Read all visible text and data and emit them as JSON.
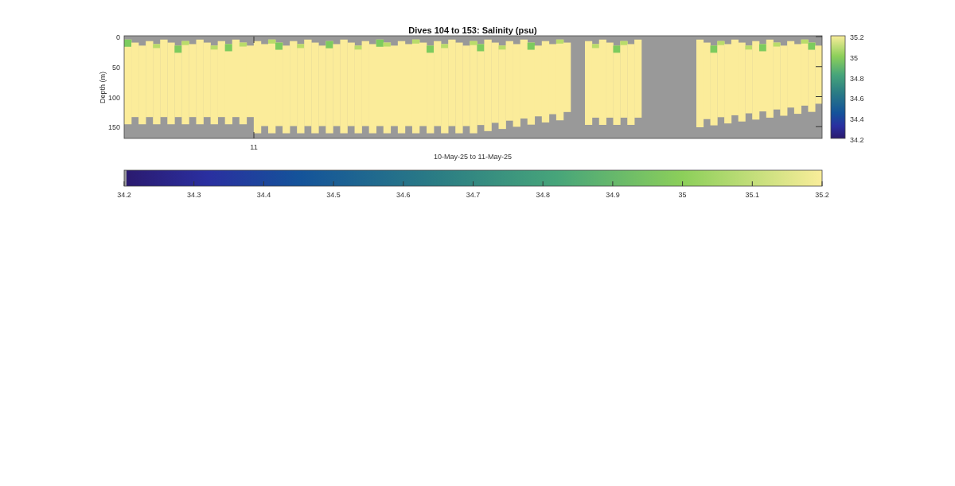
{
  "figure": {
    "title": "Dives 104 to 153: Salinity (psu)",
    "ylabel": "Depth (m)",
    "depth_ticks": [
      "0",
      "50",
      "100",
      "150"
    ],
    "time_ticks": [
      "11"
    ],
    "xlabel": "10-May-25 to 11-May-25",
    "side_colorbar_ticks": [
      "35.2",
      "35",
      "34.8",
      "34.6",
      "34.4",
      "34.2"
    ],
    "bottom_colorbar_ticks": [
      "34.2",
      "34.3",
      "34.4",
      "34.5",
      "34.6",
      "34.7",
      "34.8",
      "34.9",
      "35",
      "35.1",
      "35.2"
    ]
  }
}
